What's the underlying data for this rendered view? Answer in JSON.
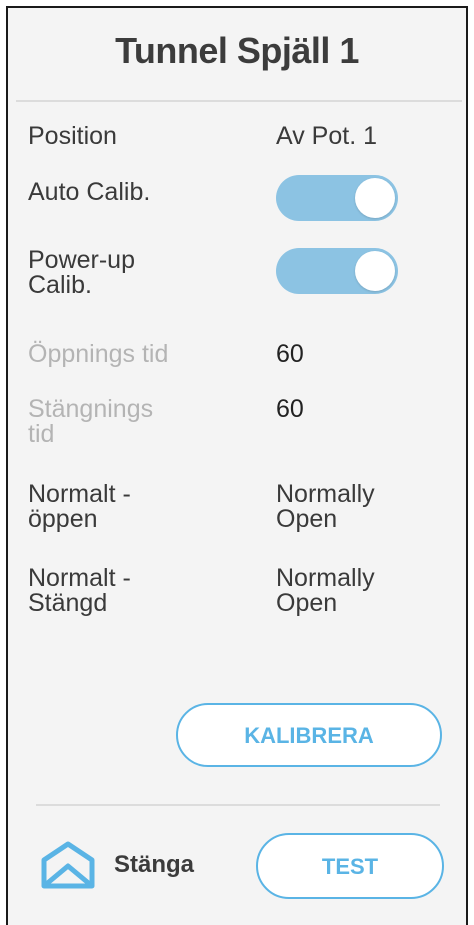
{
  "header": {
    "title": "Tunnel Spjäll 1"
  },
  "rows": {
    "position": {
      "label": "Position",
      "value": "Av Pot. 1"
    },
    "auto_calib": {
      "label": "Auto Calib.",
      "state": "on"
    },
    "powerup_calib": {
      "label_line1": "Power-up",
      "label_line2": "Calib.",
      "state": "on"
    },
    "opening_time": {
      "label": "Öppnings tid",
      "value": "60"
    },
    "closing_time": {
      "label_line1": "Stängnings",
      "label_line2": "tid",
      "value": "60"
    },
    "normally_open": {
      "label_line1": "Normalt -",
      "label_line2": "öppen",
      "value_line1": "Normally",
      "value_line2": "Open"
    },
    "normally_closed": {
      "label_line1": "Normalt -",
      "label_line2": "Stängd",
      "value_line1": "Normally",
      "value_line2": "Open"
    }
  },
  "buttons": {
    "calibrate": "KALIBRERA",
    "test": "TEST"
  },
  "footer": {
    "close_label": "Stänga"
  },
  "colors": {
    "accent": "#5ab4e5",
    "toggle_on": "#8cc3e3",
    "background": "#f4f4f4",
    "dim_text": "#b4b4b4"
  },
  "icons": {
    "close": "house-arrow-close-icon"
  }
}
